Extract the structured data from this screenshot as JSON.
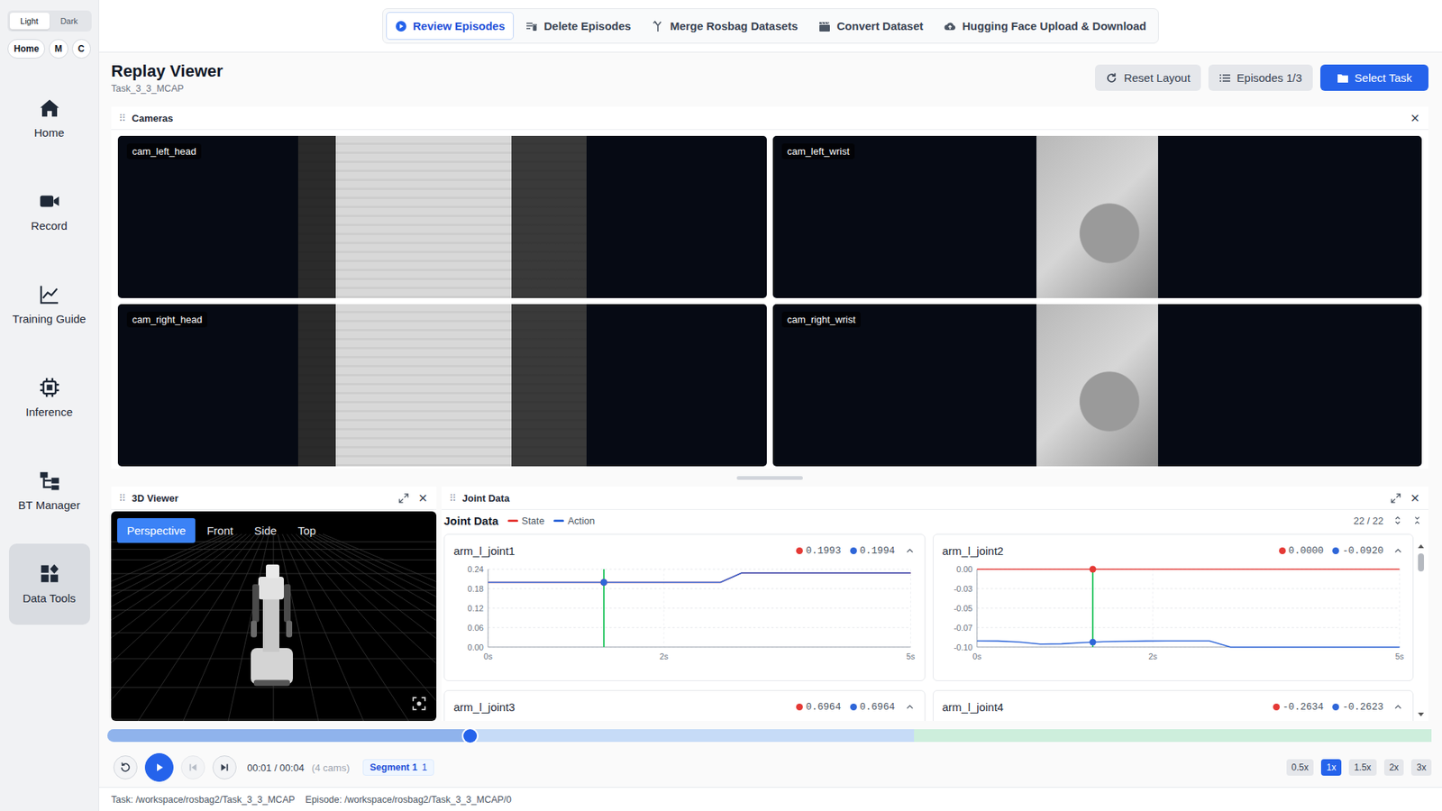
{
  "sidebar": {
    "theme": [
      {
        "label": "Light",
        "selected": true
      },
      {
        "label": "Dark",
        "selected": false
      }
    ],
    "quick": [
      "Home",
      "M",
      "C"
    ],
    "items": [
      {
        "label": "Home",
        "selected": false
      },
      {
        "label": "Record",
        "selected": false
      },
      {
        "label": "Training Guide",
        "selected": false
      },
      {
        "label": "Inference",
        "selected": false
      },
      {
        "label": "BT Manager",
        "selected": false
      },
      {
        "label": "Data Tools",
        "selected": true
      }
    ]
  },
  "topbar": {
    "tabs": [
      {
        "label": "Review Episodes",
        "selected": true
      },
      {
        "label": "Delete Episodes",
        "selected": false
      },
      {
        "label": "Merge Rosbag Datasets",
        "selected": false
      },
      {
        "label": "Convert Dataset",
        "selected": false
      },
      {
        "label": "Hugging Face Upload & Download",
        "selected": false
      }
    ]
  },
  "header": {
    "title": "Replay Viewer",
    "subtitle": "Task_3_3_MCAP",
    "buttons": [
      {
        "label": "Reset Layout",
        "primary": false
      },
      {
        "label": "Episodes 1/3",
        "primary": false
      },
      {
        "label": "Select Task",
        "primary": true
      }
    ]
  },
  "cameras": {
    "title": "Cameras",
    "close": "×",
    "feeds": [
      {
        "label": "cam_left_head",
        "kind": "head"
      },
      {
        "label": "cam_left_wrist",
        "kind": "wrist"
      },
      {
        "label": "cam_right_head",
        "kind": "head"
      },
      {
        "label": "cam_right_wrist",
        "kind": "wrist"
      }
    ]
  },
  "viewer3d": {
    "title": "3D Viewer",
    "close": "×",
    "views": [
      {
        "label": "Perspective",
        "selected": true
      },
      {
        "label": "Front",
        "selected": false
      },
      {
        "label": "Side",
        "selected": false
      },
      {
        "label": "Top",
        "selected": false
      }
    ]
  },
  "joints": {
    "title": "Joint Data",
    "close": "×",
    "heading": "Joint Data",
    "legend": [
      {
        "label": "State",
        "color": "#e53935"
      },
      {
        "label": "Action",
        "color": "#2f66d8"
      }
    ],
    "count": "22 / 22",
    "x_max": 5,
    "x_ticks": [
      {
        "label": "0s",
        "value": 0
      },
      {
        "label": "2s",
        "value": 2.08
      },
      {
        "label": "5s",
        "value": 5
      }
    ],
    "charts": [
      {
        "name": "arm_l_joint1",
        "expanded": true,
        "state_reading": "0.1993",
        "action_reading": "0.1994",
        "y_min": 0,
        "y_max": 0.24,
        "y_ticks": [
          {
            "label": "0.24",
            "value": 0.24
          },
          {
            "label": "0.18",
            "value": 0.18
          },
          {
            "label": "0.12",
            "value": 0.12
          },
          {
            "label": "0.06",
            "value": 0.06
          },
          {
            "label": "0.00",
            "value": 0
          }
        ],
        "state": [
          0.1993,
          0.1993,
          0.1993,
          0.1993,
          0.1993,
          0.1993,
          0.1993,
          0.1993,
          0.1993,
          0.1993,
          0.1993,
          0.1993,
          0.2282,
          0.2282,
          0.2282,
          0.2282,
          0.2282,
          0.2282,
          0.2282,
          0.2282,
          0.2282
        ],
        "action": [
          0.1994,
          0.1994,
          0.1994,
          0.1994,
          0.1994,
          0.1994,
          0.1994,
          0.1994,
          0.1994,
          0.1994,
          0.1994,
          0.1994,
          0.2284,
          0.2284,
          0.2284,
          0.2284,
          0.2284,
          0.2284,
          0.2284,
          0.2284,
          0.2284
        ]
      },
      {
        "name": "arm_l_joint2",
        "expanded": true,
        "state_reading": "0.0000",
        "action_reading": "-0.0920",
        "y_min": -0.1,
        "y_max": 0,
        "y_ticks": [
          {
            "label": "0.00",
            "value": 0
          },
          {
            "label": "-0.03",
            "value": -0.025
          },
          {
            "label": "-0.05",
            "value": -0.05
          },
          {
            "label": "-0.07",
            "value": -0.075
          },
          {
            "label": "-0.10",
            "value": -0.1
          }
        ],
        "state": [
          0,
          0,
          0,
          0,
          0,
          0,
          0,
          0,
          0,
          0,
          0,
          0,
          0,
          0,
          0,
          0,
          0,
          0,
          0,
          0,
          0
        ],
        "action": [
          -0.092,
          -0.0922,
          -0.0935,
          -0.0962,
          -0.0958,
          -0.0942,
          -0.093,
          -0.0925,
          -0.0922,
          -0.092,
          -0.092,
          -0.092,
          -0.1,
          -0.1,
          -0.1,
          -0.1,
          -0.1,
          -0.1,
          -0.1,
          -0.1,
          -0.1
        ]
      },
      {
        "name": "arm_l_joint3",
        "expanded": true,
        "state_reading": "0.6964",
        "action_reading": "0.6964"
      },
      {
        "name": "arm_l_joint4",
        "expanded": true,
        "state_reading": "-0.2634",
        "action_reading": "-0.2623"
      }
    ]
  },
  "player": {
    "level": 0.274,
    "segments": [
      {
        "share": 0.609,
        "color": "#c6dbf7"
      },
      {
        "share": 0.391,
        "color": "#cdeedc"
      }
    ],
    "buttons": [
      {
        "disabled": false
      },
      {
        "disabled": false
      },
      {
        "disabled": true
      },
      {
        "disabled": false
      }
    ],
    "time": "00:01 / 00:04",
    "cams": "(4 cams)",
    "segment_badge": {
      "label": "Segment 1",
      "count": "1"
    },
    "speeds": [
      {
        "label": "0.5x",
        "selected": false
      },
      {
        "label": "1x",
        "selected": true
      },
      {
        "label": "1.5x",
        "selected": false
      },
      {
        "label": "2x",
        "selected": false
      },
      {
        "label": "3x",
        "selected": false
      }
    ]
  },
  "status_bar": [
    "Task: /workspace/rosbag2/Task_3_3_MCAP",
    "Episode: /workspace/rosbag2/Task_3_3_MCAP/0"
  ]
}
